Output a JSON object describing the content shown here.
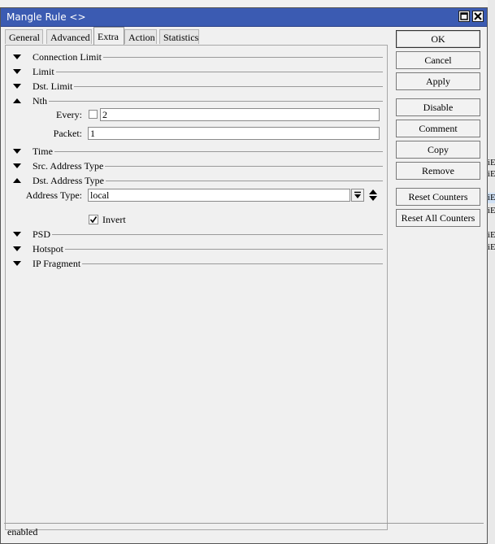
{
  "window": {
    "title": "Mangle Rule <>"
  },
  "tabs": [
    {
      "label": "General"
    },
    {
      "label": "Advanced"
    },
    {
      "label": "Extra"
    },
    {
      "label": "Action"
    },
    {
      "label": "Statistics"
    }
  ],
  "active_tab": "Extra",
  "sections": {
    "connection_limit": {
      "label": "Connection Limit",
      "expanded": false
    },
    "limit": {
      "label": "Limit",
      "expanded": false
    },
    "dst_limit": {
      "label": "Dst. Limit",
      "expanded": false
    },
    "nth": {
      "label": "Nth",
      "expanded": true
    },
    "time": {
      "label": "Time",
      "expanded": false
    },
    "src_address_type": {
      "label": "Src. Address Type",
      "expanded": false
    },
    "dst_address_type": {
      "label": "Dst. Address Type",
      "expanded": true
    },
    "psd": {
      "label": "PSD",
      "expanded": false
    },
    "hotspot": {
      "label": "Hotspot",
      "expanded": false
    },
    "ip_fragment": {
      "label": "IP Fragment",
      "expanded": false
    }
  },
  "nth": {
    "every_label": "Every:",
    "every_value": "2",
    "every_negate": false,
    "packet_label": "Packet:",
    "packet_value": "1"
  },
  "dst_address_type": {
    "address_type_label": "Address Type:",
    "address_type_value": "local",
    "invert_label": "Invert",
    "invert_checked": true
  },
  "buttons": {
    "ok": "OK",
    "cancel": "Cancel",
    "apply": "Apply",
    "disable": "Disable",
    "comment": "Comment",
    "copy": "Copy",
    "remove": "Remove",
    "reset_counters": "Reset Counters",
    "reset_all_counters": "Reset All Counters"
  },
  "status": {
    "text": "enabled"
  },
  "colors": {
    "titlebar": "#3b5bb2",
    "window_bg": "#f0f0f0"
  }
}
